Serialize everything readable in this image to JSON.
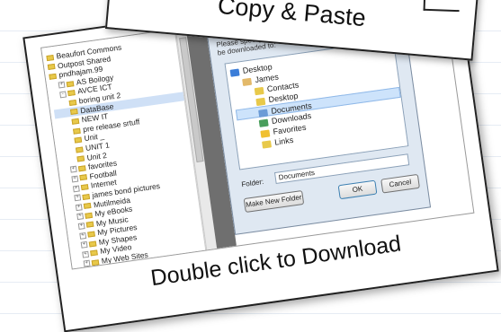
{
  "note_back": {
    "title": "Copy & Paste"
  },
  "caption": "Double click to Download",
  "tree": {
    "items": [
      {
        "label": "Beaufort Commons",
        "indent": 0,
        "exp": ""
      },
      {
        "label": "Outpost Shared",
        "indent": 0,
        "exp": ""
      },
      {
        "label": "pndhajam.99",
        "indent": 0,
        "exp": ""
      },
      {
        "label": "AS Boilogy",
        "indent": 1,
        "exp": "+"
      },
      {
        "label": "AVCE ICT",
        "indent": 1,
        "exp": "-"
      },
      {
        "label": "boring unit 2",
        "indent": 2,
        "exp": ""
      },
      {
        "label": "DataBase",
        "indent": 2,
        "exp": "",
        "selected": true
      },
      {
        "label": "NEW IT",
        "indent": 2,
        "exp": ""
      },
      {
        "label": "pre release srtuff",
        "indent": 2,
        "exp": ""
      },
      {
        "label": "Unit _",
        "indent": 2,
        "exp": ""
      },
      {
        "label": "UNIT 1",
        "indent": 2,
        "exp": ""
      },
      {
        "label": "Unit 2",
        "indent": 2,
        "exp": ""
      },
      {
        "label": "favorites",
        "indent": 1,
        "exp": "+"
      },
      {
        "label": "Football",
        "indent": 1,
        "exp": "+"
      },
      {
        "label": "Internet",
        "indent": 1,
        "exp": "+"
      },
      {
        "label": "james bond pictures",
        "indent": 1,
        "exp": "+"
      },
      {
        "label": "Mutilmeida",
        "indent": 1,
        "exp": "+"
      },
      {
        "label": "My eBooks",
        "indent": 1,
        "exp": "+"
      },
      {
        "label": "My Music",
        "indent": 1,
        "exp": "+"
      },
      {
        "label": "My Pictures",
        "indent": 1,
        "exp": "+"
      },
      {
        "label": "My Shapes",
        "indent": 1,
        "exp": "+"
      },
      {
        "label": "My Video",
        "indent": 1,
        "exp": "+"
      },
      {
        "label": "My Web Sites",
        "indent": 1,
        "exp": "+"
      }
    ]
  },
  "dialog": {
    "prompt_line1": "Please specify",
    "prompt_line2": "be downloaded to:",
    "folders": [
      {
        "label": "Desktop",
        "icon": "desktop-icon",
        "indent": 0
      },
      {
        "label": "James",
        "icon": "user-folder-icon",
        "indent": 1
      },
      {
        "label": "Contacts",
        "icon": "folder-icon",
        "indent": 2
      },
      {
        "label": "Desktop",
        "icon": "folder-icon",
        "indent": 2
      },
      {
        "label": "Documents",
        "icon": "documents-icon",
        "indent": 2,
        "selected": true
      },
      {
        "label": "Downloads",
        "icon": "downloads-icon",
        "indent": 2
      },
      {
        "label": "Favorites",
        "icon": "favorites-icon",
        "indent": 2
      },
      {
        "label": "Links",
        "icon": "folder-icon",
        "indent": 2
      }
    ],
    "folder_label": "Folder:",
    "folder_value": "Documents",
    "new_folder_label": "Make New Folder",
    "ok_label": "OK",
    "cancel_label": "Cancel"
  }
}
